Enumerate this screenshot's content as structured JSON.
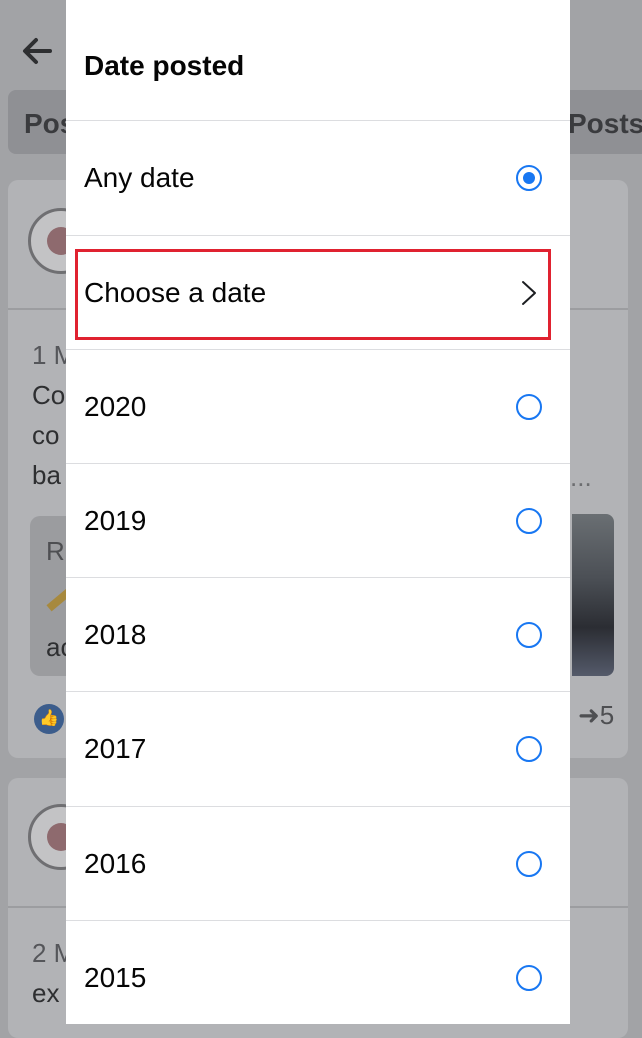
{
  "background": {
    "back_icon": "arrow-left-icon",
    "tab_left_label": "Pos",
    "tab_right_label": "Posts",
    "card1": {
      "line1": "1 M",
      "line2": "Co",
      "line3": "co",
      "line4": "ba",
      "inner_label": "R",
      "inner_text": "ac",
      "dots": "...",
      "share_count": "5"
    },
    "card2": {
      "line1": "2 M",
      "line2": "ex"
    }
  },
  "panel": {
    "title": "Date posted",
    "options": [
      {
        "label": "Any date",
        "control": "radio",
        "selected": true
      },
      {
        "label": "Choose a date",
        "control": "chevron-right-icon",
        "highlighted": true
      },
      {
        "label": "2020",
        "control": "radio",
        "selected": false
      },
      {
        "label": "2019",
        "control": "radio",
        "selected": false
      },
      {
        "label": "2018",
        "control": "radio",
        "selected": false
      },
      {
        "label": "2017",
        "control": "radio",
        "selected": false
      },
      {
        "label": "2016",
        "control": "radio",
        "selected": false
      },
      {
        "label": "2015",
        "control": "radio",
        "selected": false
      }
    ]
  },
  "colors": {
    "accent": "#1877f2",
    "highlight_box": "#e02230",
    "overlay": "#a2a3a6"
  }
}
